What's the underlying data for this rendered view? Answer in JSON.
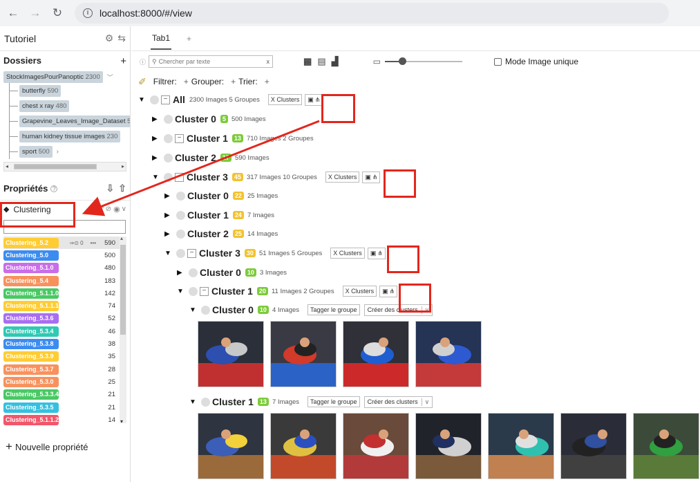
{
  "browser": {
    "url": "localhost:8000/#/view"
  },
  "sidebar": {
    "project": "Tutoriel",
    "folders_title": "Dossiers",
    "root_folder": {
      "name": "StockImagesPourPanoptic",
      "count": "2300"
    },
    "subfolders": [
      {
        "name": "butterfly",
        "count": "590"
      },
      {
        "name": "chest x ray",
        "count": "480"
      },
      {
        "name": "Grapevine_Leaves_Image_Dataset",
        "count": "5"
      },
      {
        "name": "human kidney tissue images",
        "count": "230"
      },
      {
        "name": "sport",
        "count": "500"
      }
    ],
    "properties_title": "Propriétés",
    "clustering_label": "Clustering",
    "props": [
      {
        "name": "Clustering_5.2",
        "count": "590",
        "color": "#ffcc33",
        "extra": "0",
        "more": "•••"
      },
      {
        "name": "Clustering_5.0",
        "count": "500",
        "color": "#3c8cf0"
      },
      {
        "name": "Clustering_5.1.0",
        "count": "480",
        "color": "#c96ee8"
      },
      {
        "name": "Clustering_5.4",
        "count": "183",
        "color": "#f7925e"
      },
      {
        "name": "Clustering_5.1.1.0",
        "count": "142",
        "color": "#49c964"
      },
      {
        "name": "Clustering_5.1.1.1",
        "count": "74",
        "color": "#ffcc33"
      },
      {
        "name": "Clustering_5.3.6",
        "count": "52",
        "color": "#a96ef0"
      },
      {
        "name": "Clustering_5.3.4",
        "count": "46",
        "color": "#2fc9b4"
      },
      {
        "name": "Clustering_5.3.8",
        "count": "38",
        "color": "#3c8cf0"
      },
      {
        "name": "Clustering_5.3.9",
        "count": "35",
        "color": "#ffcc33"
      },
      {
        "name": "Clustering_5.3.7",
        "count": "28",
        "color": "#f7925e"
      },
      {
        "name": "Clustering_5.3.0",
        "count": "25",
        "color": "#f7925e"
      },
      {
        "name": "Clustering_5.3.3.4",
        "count": "21",
        "color": "#49c964"
      },
      {
        "name": "Clustering_5.3.5",
        "count": "21",
        "color": "#36c0e0"
      },
      {
        "name": "Clustering_5.1.1.2",
        "count": "14",
        "color": "#f2566b"
      }
    ],
    "new_property": "Nouvelle propriété"
  },
  "main": {
    "tab": "Tab1",
    "tab_add": "+",
    "search_placeholder": "Chercher par texte",
    "mode_label": "Mode Image unique",
    "filter": "Filtrer:",
    "group": "Grouper:",
    "sort": "Trier:",
    "x_clusters": "X Clusters",
    "tag_group": "Tagger le groupe",
    "create_clusters": "Créer des clusters",
    "groups": [
      {
        "name": "All",
        "meta": "2300 Images  5 Groupes"
      },
      {
        "name": "Cluster 0",
        "badge": "5",
        "badge_color": "#7ccb3a",
        "meta": "500 Images"
      },
      {
        "name": "Cluster 1",
        "badge": "13",
        "badge_color": "#7ccb3a",
        "meta": "710 Images  2 Groupes"
      },
      {
        "name": "Cluster 2",
        "badge": "17",
        "badge_color": "#7ccb3a",
        "meta": "590 Images"
      },
      {
        "name": "Cluster 3",
        "badge": "45",
        "badge_color": "#f2c230",
        "meta": "317 Images  10 Groupes"
      },
      {
        "name": "Cluster 0",
        "badge": "22",
        "badge_color": "#f2c230",
        "meta": "25 Images"
      },
      {
        "name": "Cluster 1",
        "badge": "24",
        "badge_color": "#f2c230",
        "meta": "7 Images"
      },
      {
        "name": "Cluster 2",
        "badge": "25",
        "badge_color": "#f2c230",
        "meta": "14 Images"
      },
      {
        "name": "Cluster 3",
        "badge": "30",
        "badge_color": "#f2c230",
        "meta": "51 Images  5 Groupes"
      },
      {
        "name": "Cluster 0",
        "badge": "10",
        "badge_color": "#7ccb3a",
        "meta": "3 Images"
      },
      {
        "name": "Cluster 1",
        "badge": "20",
        "badge_color": "#7ccb3a",
        "meta": "11 Images  2 Groupes"
      },
      {
        "name": "Cluster 0",
        "badge": "10",
        "badge_color": "#7ccb3a",
        "meta": "4 Images"
      },
      {
        "name": "Cluster 1",
        "badge": "13",
        "badge_color": "#7ccb3a",
        "meta": "7 Images"
      }
    ]
  }
}
